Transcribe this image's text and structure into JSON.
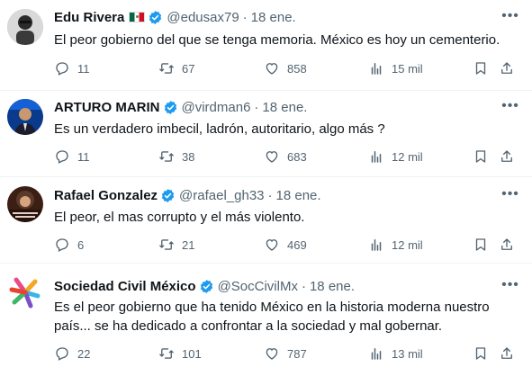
{
  "tweets": [
    {
      "name": "Edu Rivera",
      "has_flag": true,
      "handle": "@edusax79",
      "date": "18 ene.",
      "text": "El peor gobierno del que se tenga memoria. México es hoy un cementerio.",
      "replies": "11",
      "retweets": "67",
      "likes": "858",
      "views": "15 mil"
    },
    {
      "name": "ARTURO MARIN",
      "handle": "@virdman6",
      "date": "18 ene.",
      "text": "Es un verdadero imbecil, ladrón, autoritario, algo más ?",
      "replies": "11",
      "retweets": "38",
      "likes": "683",
      "views": "12 mil"
    },
    {
      "name": "Rafael Gonzalez",
      "handle": "@rafael_gh33",
      "date": "18 ene.",
      "text": "El peor, el mas corrupto y el más violento.",
      "replies": "6",
      "retweets": "21",
      "likes": "469",
      "views": "12 mil"
    },
    {
      "name": "Sociedad Civil México",
      "handle": "@SocCivilMx",
      "date": "18 ene.",
      "text_line1": "Es el peor gobierno que ha tenido México en la historia moderna nuestro",
      "text_line2": "país... se ha dedicado a confrontar a la sociedad y mal gobernar.",
      "replies": "22",
      "retweets": "101",
      "likes": "787",
      "views": "13 mil"
    }
  ],
  "separator": "·",
  "colors": {
    "verified": "#1d9bf0",
    "muted": "#536471",
    "text": "#0f1419"
  }
}
